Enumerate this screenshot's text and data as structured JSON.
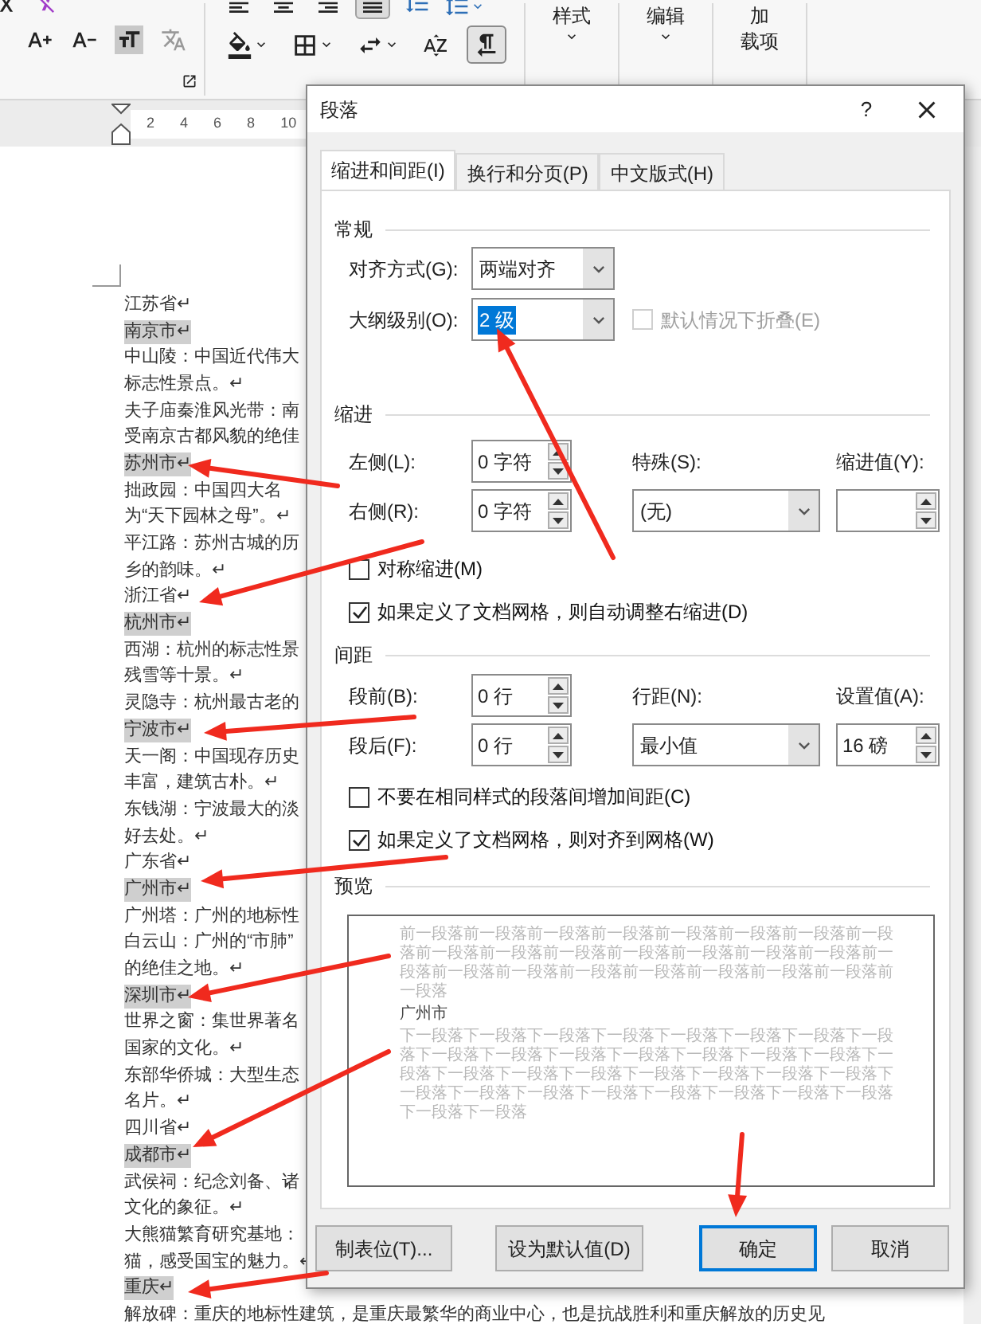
{
  "ribbon": {
    "font_tools": [
      {
        "kind": "grow"
      },
      {
        "kind": "shrink"
      },
      {
        "kind": "shade"
      },
      {
        "kind": "phonetic"
      }
    ],
    "align_buttons": [
      {
        "kind": "left",
        "selected": false
      },
      {
        "kind": "center",
        "selected": false
      },
      {
        "kind": "right",
        "selected": false
      },
      {
        "kind": "justify",
        "selected": true
      },
      {
        "kind": "distributed",
        "selected": false
      }
    ],
    "paragraph_tools": [
      {
        "kind": "fill",
        "selected": false
      },
      {
        "kind": "borders",
        "selected": false
      },
      {
        "kind": "spacing",
        "selected": false
      },
      {
        "kind": "sort",
        "selected": false
      },
      {
        "kind": "rtl",
        "selected": true
      }
    ],
    "big_buttons": [
      {
        "lines": [
          "样式"
        ]
      },
      {
        "lines": [
          "编辑"
        ]
      },
      {
        "lines": [
          "加",
          "载项"
        ]
      }
    ]
  },
  "ruler": {
    "ticks": [
      "2",
      "4",
      "6",
      "8",
      "10"
    ]
  },
  "document": {
    "lines": [
      {
        "text": "江苏省↵",
        "heading": false
      },
      {
        "text": "南京市↵",
        "heading": true
      },
      {
        "text": "中山陵：中国近代伟大",
        "heading": false
      },
      {
        "text": "标志性景点。↵",
        "heading": false
      },
      {
        "text": "夫子庙秦淮风光带：南",
        "heading": false
      },
      {
        "text": "受南京古都风貌的绝佳",
        "heading": false
      },
      {
        "text": "苏州市↵",
        "heading": true
      },
      {
        "text": "拙政园：中国四大名",
        "heading": false
      },
      {
        "text": "为“天下园林之母”。↵",
        "heading": false
      },
      {
        "text": "平江路：苏州古城的历",
        "heading": false
      },
      {
        "text": "乡的韵味。↵",
        "heading": false
      },
      {
        "text": "浙江省↵",
        "heading": false
      },
      {
        "text": "杭州市↵",
        "heading": true
      },
      {
        "text": "西湖：杭州的标志性景",
        "heading": false
      },
      {
        "text": "残雪等十景。↵",
        "heading": false
      },
      {
        "text": "灵隐寺：杭州最古老的",
        "heading": false
      },
      {
        "text": "宁波市↵",
        "heading": true
      },
      {
        "text": "天一阁：中国现存历史",
        "heading": false
      },
      {
        "text": "丰富，建筑古朴。↵",
        "heading": false
      },
      {
        "text": "东钱湖：宁波最大的淡",
        "heading": false
      },
      {
        "text": "好去处。↵",
        "heading": false
      },
      {
        "text": "广东省↵",
        "heading": false
      },
      {
        "text": "广州市↵",
        "heading": true
      },
      {
        "text": "广州塔：广州的地标性",
        "heading": false
      },
      {
        "text": "白云山：广州的“市肺”",
        "heading": false
      },
      {
        "text": "的绝佳之地。↵",
        "heading": false
      },
      {
        "text": "深圳市↵",
        "heading": true
      },
      {
        "text": "世界之窗：集世界著名",
        "heading": false
      },
      {
        "text": "国家的文化。↵",
        "heading": false
      },
      {
        "text": "东部华侨城：大型生态",
        "heading": false
      },
      {
        "text": "名片。↵",
        "heading": false
      },
      {
        "text": "四川省↵",
        "heading": false
      },
      {
        "text": "成都市↵",
        "heading": true
      },
      {
        "text": "武侯祠：纪念刘备、诸",
        "heading": false
      },
      {
        "text": "文化的象征。↵",
        "heading": false
      },
      {
        "text": "大熊猫繁育研究基地：",
        "heading": false
      },
      {
        "text": "猫，感受国宝的魅力。↵",
        "heading": false
      },
      {
        "text": "重庆↵",
        "heading": true
      },
      {
        "text": "解放碑：重庆的地标性建筑，是重庆最繁华的商业中心，也是抗战胜利和重庆解放的历史见",
        "heading": false
      }
    ]
  },
  "dialog": {
    "title": "段落",
    "help": "?",
    "tabs": [
      {
        "label": "缩进和间距(I)",
        "selected": true
      },
      {
        "label": "换行和分页(P)",
        "selected": false
      },
      {
        "label": "中文版式(H)",
        "selected": false
      }
    ],
    "general": {
      "heading": "常规",
      "alignment": {
        "label": "对齐方式(G):",
        "value": "两端对齐"
      },
      "outline_level": {
        "label": "大纲级别(O):",
        "value": "2 级",
        "focused": true
      },
      "collapse": {
        "label": "默认情况下折叠(E)",
        "checked": false,
        "disabled": true
      }
    },
    "indent": {
      "heading": "缩进",
      "left": {
        "label": "左侧(L):",
        "value": "0 字符"
      },
      "right": {
        "label": "右侧(R):",
        "value": "0 字符"
      },
      "special": {
        "label": "特殊(S):",
        "value": "(无)"
      },
      "by": {
        "label": "缩进值(Y):"
      },
      "checkboxes": [
        {
          "label": "对称缩进(M)",
          "checked": false
        },
        {
          "label": "如果定义了文档网格，则自动调整右缩进(D)",
          "checked": true
        }
      ]
    },
    "spacing": {
      "heading": "间距",
      "before": {
        "label": "段前(B):",
        "value": "0 行"
      },
      "after": {
        "label": "段后(F):",
        "value": "0 行"
      },
      "line_spacing": {
        "label": "行距(N):",
        "value": "最小值"
      },
      "at": {
        "label": "设置值(A):",
        "value": "16 磅"
      },
      "checkboxes": [
        {
          "label": "不要在相同样式的段落间增加间距(C)",
          "checked": false
        },
        {
          "label": "如果定义了文档网格，则对齐到网格(W)",
          "checked": true
        }
      ]
    },
    "preview": {
      "heading": "预览",
      "previous": "前一段落前一段落前一段落前一段落前一段落前一段落前一段落前一段落前一段落前一段落前一段落前一段落前一段落前一段落前一段落前一段落前一段落前一段落前一段落前一段落前一段落前一段落前一段落前一段落",
      "current": "广州市",
      "next": "下一段落下一段落下一段落下一段落下一段落下一段落下一段落下一段落下一段落下一段落下一段落下一段落下一段落下一段落下一段落下一段落下一段落下一段落下一段落下一段落下一段落下一段落下一段落下一段落下一段落下一段落下一段落下一段落下一段落下一段落下一段落下一段落下一段落"
    },
    "buttons": [
      {
        "label": "制表位(T)...",
        "default": false
      },
      {
        "label": "设为默认值(D)",
        "default": false
      },
      {
        "label": "确定",
        "default": true
      },
      {
        "label": "取消",
        "default": false
      }
    ]
  }
}
